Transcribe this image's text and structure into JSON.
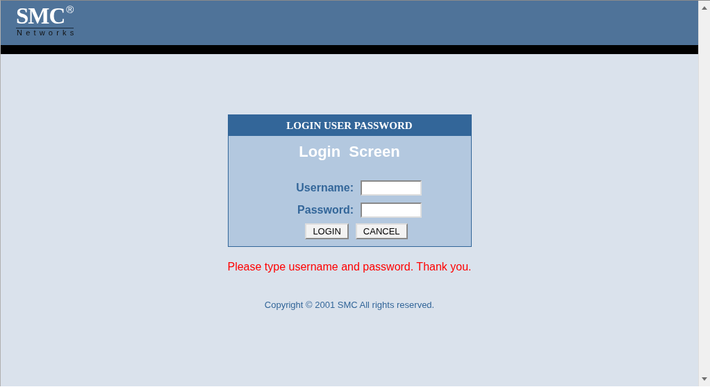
{
  "header": {
    "logo": {
      "text": "SMC",
      "mark": "®",
      "subtitle": "Networks"
    }
  },
  "login_box": {
    "title": "LOGIN USER PASSWORD",
    "heading": "Login  Screen",
    "fields": [
      {
        "label": "Username:"
      },
      {
        "label": "Password:"
      }
    ],
    "buttons": [
      "LOGIN",
      "CANCEL"
    ]
  },
  "message": "Please type username and password. Thank you.",
  "copyright": "Copyright © 2001 SMC All rights reserved."
}
